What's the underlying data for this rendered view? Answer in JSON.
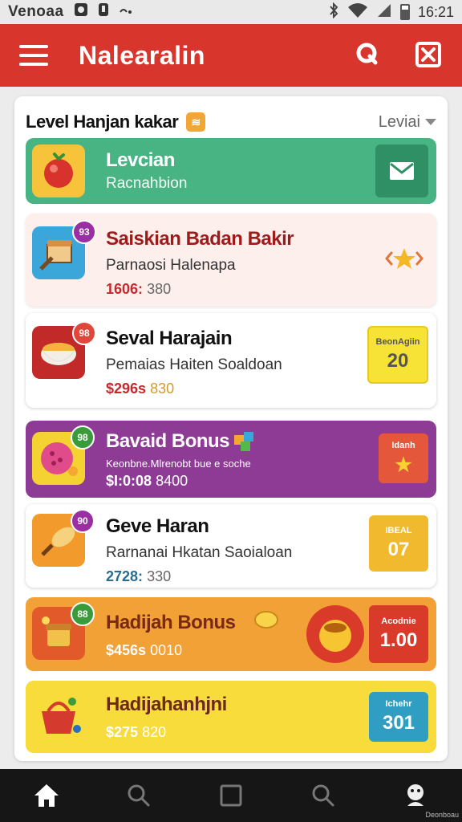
{
  "status_bar": {
    "carrier": "Venoaa",
    "time": "16:21",
    "icons": [
      "photo-icon",
      "notification-icon",
      "cast-icon",
      "bluetooth-icon",
      "wifi-icon",
      "battery-icon"
    ]
  },
  "app_bar": {
    "title": "Nalearalin",
    "icons": [
      "menu-icon",
      "search-icon",
      "close-icon"
    ]
  },
  "panel": {
    "title": "Level Hanjan kakar",
    "badge_icon": "gift-icon",
    "level_select": "Leviai"
  },
  "rows": [
    {
      "title": "Levcian",
      "subtitle": "Racnahbion",
      "icon": "tomato-icon",
      "action_icon": "mail-icon",
      "color": "#48b383"
    },
    {
      "title": "Saiskian Badan Bakir",
      "subtitle": "Parnaosi Halenapa",
      "price_a": "1606:",
      "price_b": "380",
      "badge": "93",
      "icon": "box-icon",
      "action_icon": "star-icon",
      "color": "#fdf0ec"
    },
    {
      "title": "Seval Harajain",
      "subtitle": "Pemaias Haiten Soaldoan",
      "price_a": "$296s",
      "price_b": "830",
      "badge": "98",
      "icon": "bowl-icon",
      "tag_label": "BeonAgiin",
      "tag_value": "20",
      "color": "#ffffff"
    },
    {
      "title": "Bavaid Bonus",
      "subtitle": "Keonbne.Mlrenobt bue e soche",
      "price_a": "$I:0:08",
      "price_b": "8400",
      "badge": "98",
      "icon": "donut-icon",
      "side_icon": "cube-icon",
      "tag_label": "Idanh",
      "tag_value": "★",
      "color": "#8e3b96"
    },
    {
      "title": "Geve Haran",
      "subtitle": "Rarnanai Hkatan Saoialoan",
      "price_a": "2728:",
      "price_b": "330",
      "badge": "90",
      "icon": "bread-icon",
      "tag_label": "IBEAL",
      "tag_value": "07",
      "color": "#ffffff"
    },
    {
      "title": "Hadijah Bonus",
      "subtitle": "",
      "price_a": "$456s",
      "price_b": "0010",
      "badge": "88",
      "icon": "treasure-icon",
      "side_icon": "coin-icon",
      "extra_icon": "pot-icon",
      "tag_label": "Acodnie",
      "tag_value": "1.00",
      "color": "#f1a135"
    },
    {
      "title": "Hadijahanhjni",
      "subtitle": "",
      "price_a": "$275",
      "price_b": "820",
      "icon": "basket-icon",
      "tag_label": "Ichehr",
      "tag_value": "301",
      "color": "#f7dc3c"
    }
  ],
  "bottom_nav": {
    "items": [
      "home-icon",
      "search-icon",
      "square-icon",
      "search-icon",
      "profile-icon"
    ],
    "caption": "Deonboau"
  }
}
